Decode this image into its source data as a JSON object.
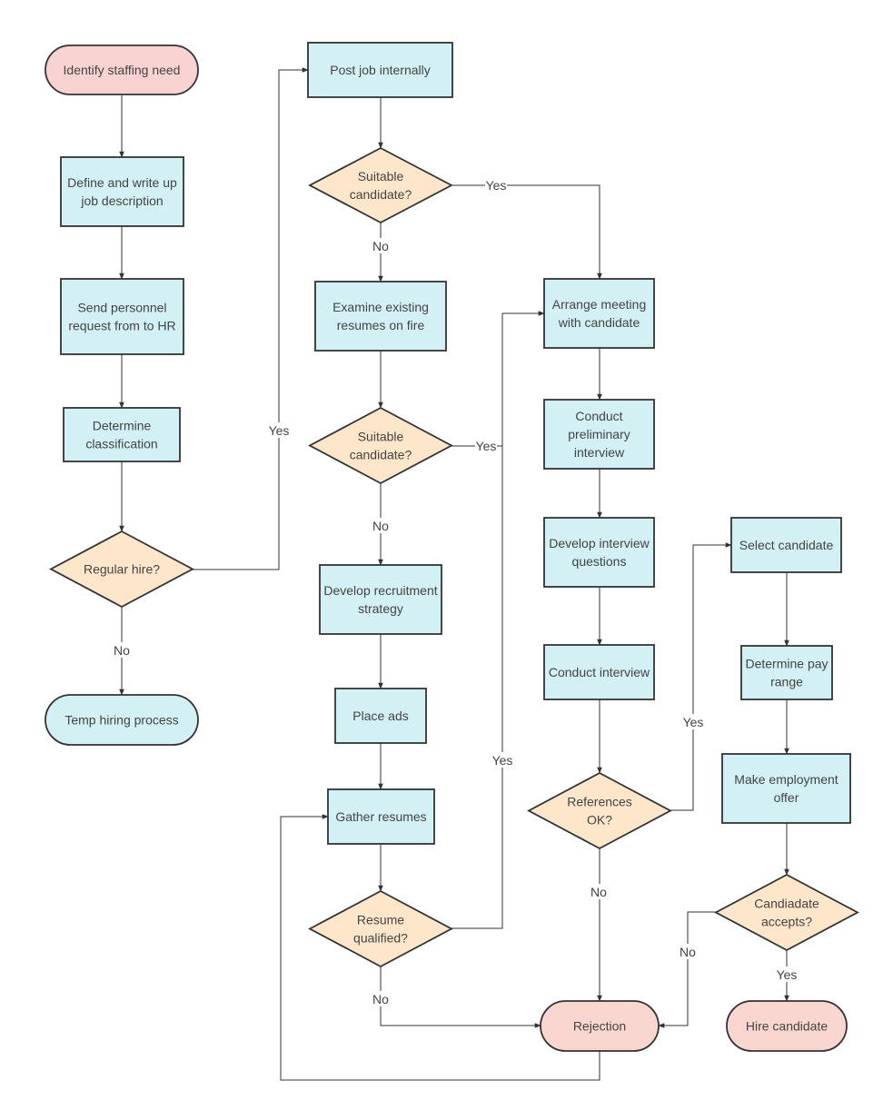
{
  "colors": {
    "process": "#d3f0f5",
    "decision": "#fde6c9",
    "terminator_start": "#f9d3d1",
    "terminator_end": "#f9d6cf",
    "terminator_alt": "#d3f0f5",
    "stroke": "#333333"
  },
  "nodes": [
    {
      "id": "identify",
      "shape": "terminator",
      "fill": "terminator_start",
      "lines": [
        "Identify staffing need"
      ]
    },
    {
      "id": "define",
      "shape": "process",
      "lines": [
        "Define and write up",
        "job description"
      ]
    },
    {
      "id": "send",
      "shape": "process",
      "lines": [
        "Send personnel",
        "request from to HR"
      ]
    },
    {
      "id": "classify",
      "shape": "process",
      "lines": [
        "Determine",
        "classification"
      ]
    },
    {
      "id": "regular",
      "shape": "decision",
      "lines": [
        "Regular hire?"
      ]
    },
    {
      "id": "temp",
      "shape": "terminator",
      "fill": "terminator_alt",
      "lines": [
        "Temp hiring process"
      ]
    },
    {
      "id": "post",
      "shape": "process",
      "lines": [
        "Post job internally"
      ]
    },
    {
      "id": "suit1",
      "shape": "decision",
      "lines": [
        "Suitable",
        "candidate?"
      ]
    },
    {
      "id": "examine",
      "shape": "process",
      "lines": [
        "Examine existing",
        "resumes on fire"
      ]
    },
    {
      "id": "suit2",
      "shape": "decision",
      "lines": [
        "Suitable",
        "candidate?"
      ]
    },
    {
      "id": "strategy",
      "shape": "process",
      "lines": [
        "Develop recruitment",
        "strategy"
      ]
    },
    {
      "id": "ads",
      "shape": "process",
      "lines": [
        "Place ads"
      ]
    },
    {
      "id": "gather",
      "shape": "process",
      "lines": [
        "Gather resumes"
      ]
    },
    {
      "id": "qualified",
      "shape": "decision",
      "lines": [
        "Resume",
        "qualified?"
      ]
    },
    {
      "id": "arrange",
      "shape": "process",
      "lines": [
        "Arrange meeting",
        "with candidate"
      ]
    },
    {
      "id": "prelim",
      "shape": "process",
      "lines": [
        "Conduct",
        "preliminary",
        "interview"
      ]
    },
    {
      "id": "questions",
      "shape": "process",
      "lines": [
        "Develop interview",
        "questions"
      ]
    },
    {
      "id": "interview",
      "shape": "process",
      "lines": [
        "Conduct interview"
      ]
    },
    {
      "id": "refs",
      "shape": "decision",
      "lines": [
        "References",
        "OK?"
      ]
    },
    {
      "id": "rejection",
      "shape": "terminator",
      "fill": "terminator_end",
      "lines": [
        "Rejection"
      ]
    },
    {
      "id": "select",
      "shape": "process",
      "lines": [
        "Select candidate"
      ]
    },
    {
      "id": "pay",
      "shape": "process",
      "lines": [
        "Determine pay",
        "range"
      ]
    },
    {
      "id": "offer",
      "shape": "process",
      "lines": [
        "Make employment",
        "offer"
      ]
    },
    {
      "id": "accepts",
      "shape": "decision",
      "lines": [
        "Candiadate",
        "accepts?"
      ]
    },
    {
      "id": "hire",
      "shape": "terminator",
      "fill": "terminator_end",
      "lines": [
        "Hire candidate"
      ]
    }
  ],
  "edges": [
    {
      "id": "identify-define",
      "from": "identify",
      "to": "define",
      "label": ""
    },
    {
      "id": "define-send",
      "from": "define",
      "to": "send",
      "label": ""
    },
    {
      "id": "send-classify",
      "from": "send",
      "to": "classify",
      "label": ""
    },
    {
      "id": "classify-regular",
      "from": "classify",
      "to": "regular",
      "label": ""
    },
    {
      "id": "regular-temp",
      "from": "regular",
      "to": "temp",
      "label": "No"
    },
    {
      "id": "regular-post",
      "from": "regular",
      "to": "post",
      "label": "Yes"
    },
    {
      "id": "post-suit1",
      "from": "post",
      "to": "suit1",
      "label": ""
    },
    {
      "id": "suit1-arrange",
      "from": "suit1",
      "to": "arrange",
      "label": "Yes"
    },
    {
      "id": "suit1-examine",
      "from": "suit1",
      "to": "examine",
      "label": "No"
    },
    {
      "id": "examine-suit2",
      "from": "examine",
      "to": "suit2",
      "label": ""
    },
    {
      "id": "suit2-arrange",
      "from": "suit2",
      "to": "arrange",
      "label": "Yes"
    },
    {
      "id": "suit2-strategy",
      "from": "suit2",
      "to": "strategy",
      "label": "No"
    },
    {
      "id": "strategy-ads",
      "from": "strategy",
      "to": "ads",
      "label": ""
    },
    {
      "id": "ads-gather",
      "from": "ads",
      "to": "gather",
      "label": ""
    },
    {
      "id": "gather-qualified",
      "from": "gather",
      "to": "qualified",
      "label": ""
    },
    {
      "id": "qualified-arrange",
      "from": "qualified",
      "to": "arrange",
      "label": "Yes"
    },
    {
      "id": "qualified-rejection",
      "from": "qualified",
      "to": "rejection",
      "label": "No"
    },
    {
      "id": "rejection-gather",
      "from": "rejection",
      "to": "gather",
      "label": ""
    },
    {
      "id": "arrange-prelim",
      "from": "arrange",
      "to": "prelim",
      "label": ""
    },
    {
      "id": "prelim-questions",
      "from": "prelim",
      "to": "questions",
      "label": ""
    },
    {
      "id": "questions-interview",
      "from": "questions",
      "to": "interview",
      "label": ""
    },
    {
      "id": "interview-refs",
      "from": "interview",
      "to": "refs",
      "label": ""
    },
    {
      "id": "refs-rejection",
      "from": "refs",
      "to": "rejection",
      "label": "No"
    },
    {
      "id": "refs-select",
      "from": "refs",
      "to": "select",
      "label": "Yes"
    },
    {
      "id": "select-pay",
      "from": "select",
      "to": "pay",
      "label": ""
    },
    {
      "id": "pay-offer",
      "from": "pay",
      "to": "offer",
      "label": ""
    },
    {
      "id": "offer-accepts",
      "from": "offer",
      "to": "accepts",
      "label": ""
    },
    {
      "id": "accepts-rejection",
      "from": "accepts",
      "to": "rejection",
      "label": "No"
    },
    {
      "id": "accepts-hire",
      "from": "accepts",
      "to": "hire",
      "label": "Yes"
    }
  ]
}
